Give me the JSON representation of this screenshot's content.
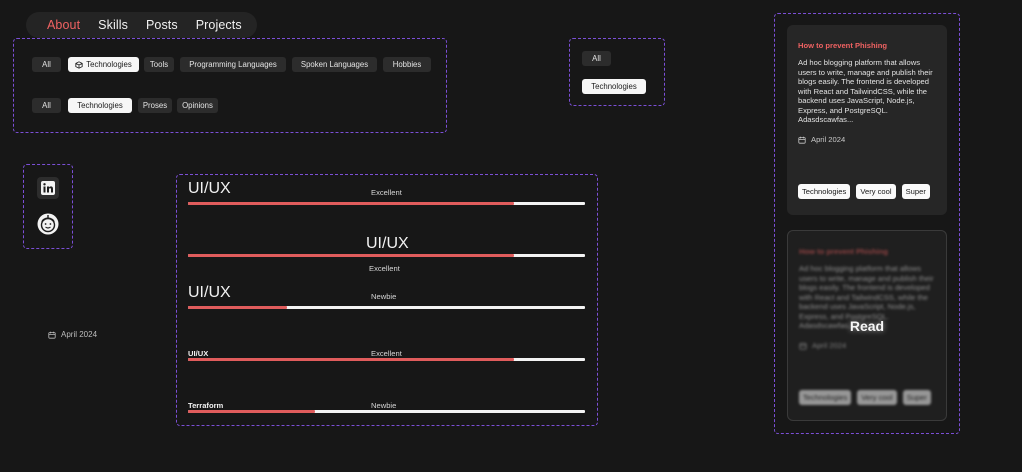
{
  "nav": {
    "items": [
      {
        "label": "About",
        "active": true
      },
      {
        "label": "Skills",
        "active": false
      },
      {
        "label": "Posts",
        "active": false
      },
      {
        "label": "Projects",
        "active": false
      }
    ]
  },
  "filters_row1": [
    "All",
    "Technologies",
    "Tools",
    "Programming Languages",
    "Spoken Languages",
    "Hobbies"
  ],
  "filters_row2": [
    "All",
    "Technologies",
    "Proses",
    "Opinions"
  ],
  "filters_small": [
    "All",
    "Technologies"
  ],
  "social": {
    "linkedin": "linkedin-icon",
    "avatar": "emoji-avatar-icon"
  },
  "standalone_date": "April 2024",
  "skills": [
    {
      "name": "UI/UX",
      "level": "Excellent",
      "progress": 0.82
    },
    {
      "name": "UI/UX",
      "level": "Excellent",
      "progress": 0.82
    },
    {
      "name": "UI/UX",
      "level": "Newbie",
      "progress": 0.25
    },
    {
      "name": "UI/UX",
      "level": "Excellent",
      "progress": 0.82
    },
    {
      "name": "Terraform",
      "level": "Newbie",
      "progress": 0.32
    }
  ],
  "posts": [
    {
      "title": "How to prevent Phishing",
      "description": "Ad hoc blogging platform that allows users to write, manage and publish their blogs easily. The frontend is developed with React and TailwindCSS, while the backend uses JavaScript, Node.js, Express, and PostgreSQL. Adasdscawfas...",
      "date": "April 2024",
      "tags": [
        "Technologies",
        "Very cool",
        "Super"
      ]
    },
    {
      "title": "How to prevent Phishing",
      "description": "Ad hoc blogging platform that allows users to write, manage and publish their blogs easily. The frontend is developed with React and TailwindCSS, while the backend uses JavaScript, Node.js, Express, and PostgreSQL. Adasdscawfas...",
      "date": "April 2024",
      "tags": [
        "Technologies",
        "Very cool",
        "Super"
      ],
      "hover_label": "Read"
    }
  ],
  "colors": {
    "accent": "#ef6262",
    "background": "#171717",
    "dashed_border": "#7b4fd6"
  }
}
